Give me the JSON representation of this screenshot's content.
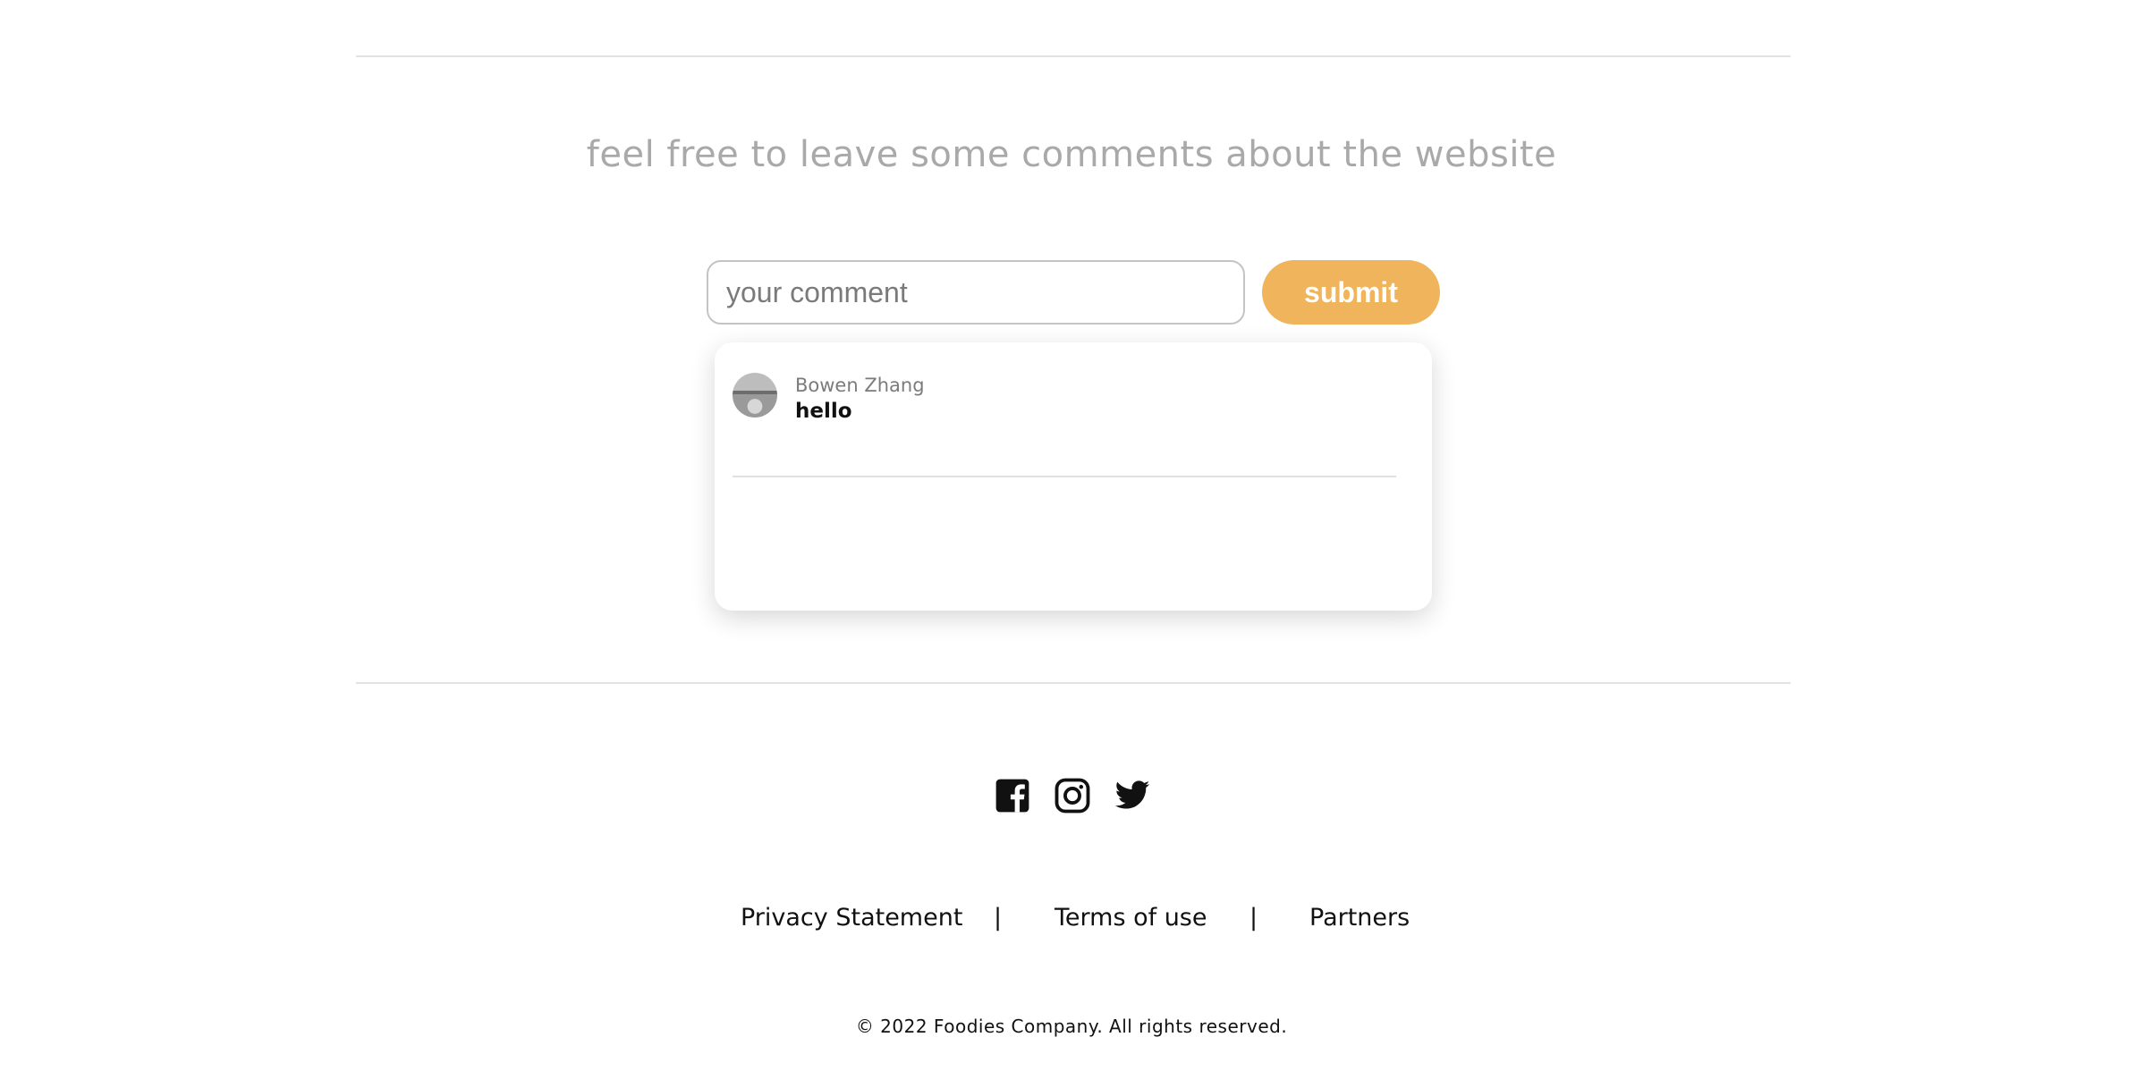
{
  "comments_section": {
    "heading": "feel free to leave some comments about the website",
    "input_placeholder": "your comment",
    "input_value": "",
    "submit_label": "submit",
    "accent_color": "#f0b45c",
    "comments": [
      {
        "author": "Bowen Zhang",
        "text": "hello",
        "avatar": "user-avatar-photo"
      }
    ]
  },
  "footer": {
    "social_icons": [
      "facebook-icon",
      "instagram-icon",
      "twitter-icon"
    ],
    "links": {
      "privacy": "Privacy Statement",
      "terms": "Terms of use",
      "partners": "Partners",
      "separator": "|"
    },
    "copyright": "© 2022 Foodies Company. All rights reserved."
  }
}
